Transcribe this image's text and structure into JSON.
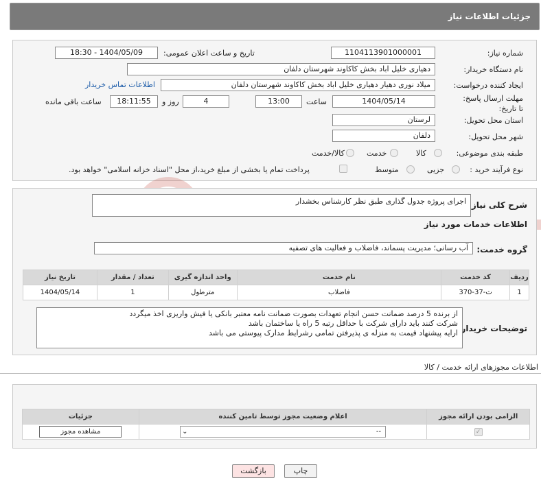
{
  "header": {
    "title": "جزئیات اطلاعات نیاز"
  },
  "fields": {
    "need_number_label": "شماره نیاز:",
    "need_number": "1104113901000001",
    "announce_label": "تاریخ و ساعت اعلان عمومی:",
    "announce_value": "1404/05/09 - 18:30",
    "buyer_org_label": "نام دستگاه خریدار:",
    "buyer_org": "دهیاری خلیل اباد بخش کاکاوند شهرستان دلفان",
    "creator_label": "ایجاد کننده درخواست:",
    "creator": "میلاد نوری دهیار دهیاری خلیل اباد بخش کاکاوند شهرستان دلفان",
    "contact_link": "اطلاعات تماس خریدار",
    "deadline_label": "مهلت ارسال پاسخ: تا تاریخ:",
    "deadline_date": "1404/05/14",
    "time_label": "ساعت",
    "deadline_time": "13:00",
    "days_value": "4",
    "days_label": "روز و",
    "remaining_time": "18:11:55",
    "remaining_label": "ساعت باقی مانده",
    "province_label": "استان محل تحویل:",
    "province": "لرستان",
    "city_label": "شهر محل تحویل:",
    "city": "دلفان",
    "category_label": "طبقه بندی موضوعی:",
    "category_options": [
      "کالا",
      "خدمت",
      "کالا/خدمت"
    ],
    "process_label": "نوع فرآیند خرید :",
    "process_options": [
      "جزیی",
      "متوسط"
    ],
    "payment_note": "پرداخت تمام یا بخشی از مبلغ خرید،از محل \"اسناد خزانه اسلامی\" خواهد بود."
  },
  "summary": {
    "label": "شرح کلی نیاز:",
    "value": "اجرای پروژه جدول گذاری طبق نظر کارشناس بخشدار"
  },
  "services_title": "اطلاعات خدمات مورد نیاز",
  "service_group": {
    "label": "گروه خدمت:",
    "value": "آب رسانی؛ مدیریت پسماند، فاضلاب و فعالیت های تصفیه"
  },
  "table": {
    "headers": [
      "ردیف",
      "کد خدمت",
      "نام خدمت",
      "واحد اندازه گیری",
      "تعداد / مقدار",
      "تاریخ نیاز"
    ],
    "rows": [
      [
        "1",
        "ث-37-370",
        "فاضلاب",
        "مترطول",
        "1",
        "1404/05/14"
      ]
    ]
  },
  "buyer_notes": {
    "label": "توضیحات خریدار:",
    "lines": [
      "از برنده 5 درصد ضمانت حسن انجام تعهدات بصورت ضمانت نامه معتبر بانکی یا فیش واریزی اخذ میگردد",
      "شرکت کنند باید دارای شرکت با حداقل رتبه 5 راه یا ساختمان باشد",
      "ارایه پیشنهاد قیمت به منزله ی پذیرفتن تمامی رشرایط مدارک پیوستی می باشد"
    ]
  },
  "permits": {
    "title": "اطلاعات مجوزهای ارائه خدمت / کالا",
    "headers": [
      "الزامی بودن ارائه مجوز",
      "اعلام وضعیت مجوز توسط تامین کننده",
      "جزئیات"
    ],
    "select_value": "--",
    "view_button": "مشاهده مجوز"
  },
  "buttons": {
    "print": "چاپ",
    "back": "بازگشت"
  },
  "watermark": "AriaTender.neT",
  "colors": {
    "header": "#7a7a7a",
    "link": "#1a5aa8",
    "back_button": "#fde3e3",
    "watermark": "#c0392b"
  }
}
